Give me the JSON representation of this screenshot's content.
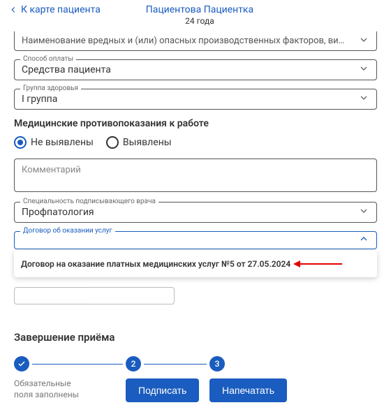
{
  "header": {
    "back_label": "К карте пациента",
    "patient_name": "Пациентова Пациентка",
    "patient_age": "24 года"
  },
  "truncated_top": "Наименование вредных и (или) опасных производственных факторов, видов работ",
  "fields": {
    "payment": {
      "label": "Способ оплаты",
      "value": "Средства пациента"
    },
    "health_group": {
      "label": "Группа здоровья",
      "value": "I группа"
    },
    "specialty": {
      "label": "Специальность подписывающего врача",
      "value": "Профпатология"
    },
    "contract": {
      "label": "Договор об оказании услуг"
    }
  },
  "contra": {
    "title": "Медицинские противопоказания к работе",
    "opt_no": "Не выявлены",
    "opt_yes": "Выявлены"
  },
  "comment_placeholder": "Комментарий",
  "dropdown_item": "Договор на оказание платных медицинских услуг №5 от 27.05.2024",
  "completion": {
    "title": "Завершение приёма",
    "step1_text": "Обязательные поля заполнены",
    "step2_num": "2",
    "step3_num": "3",
    "sign_btn": "Подписать",
    "print_btn": "Напечатать"
  }
}
